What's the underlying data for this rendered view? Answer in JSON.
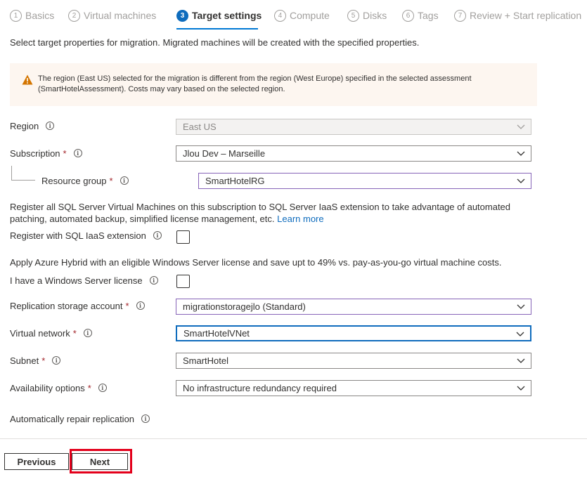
{
  "wizard": {
    "steps": [
      {
        "num": "1",
        "label": "Basics"
      },
      {
        "num": "2",
        "label": "Virtual machines"
      },
      {
        "num": "3",
        "label": "Target settings"
      },
      {
        "num": "4",
        "label": "Compute"
      },
      {
        "num": "5",
        "label": "Disks"
      },
      {
        "num": "6",
        "label": "Tags"
      },
      {
        "num": "7",
        "label": "Review + Start replication"
      }
    ],
    "active_step": "3"
  },
  "intro_text": "Select target properties for migration. Migrated machines will be created with the specified properties.",
  "warning": {
    "icon": "warning-triangle-icon",
    "text": "The region (East US) selected for the migration is different from the region (West Europe) specified in the selected assessment (SmartHotelAssessment). Costs may vary based on the selected region."
  },
  "fields": {
    "region": {
      "label": "Region",
      "value": "East US"
    },
    "subscription": {
      "label": "Subscription",
      "value": "Jlou Dev – Marseille"
    },
    "resource_group": {
      "label": "Resource group",
      "value": "SmartHotelRG"
    },
    "sql_text": "Register all SQL Server Virtual Machines on this subscription to SQL Server IaaS extension to take advantage of automated patching, automated backup, simplified license management, etc.",
    "sql_link": "Learn more",
    "sql_checkbox_label": "Register with SQL IaaS extension",
    "hybrid_text": "Apply Azure Hybrid with an eligible Windows Server license and save upt to 49% vs. pay-as-you-go virtual machine costs.",
    "license_checkbox_label": "I have a Windows Server license",
    "storage": {
      "label": "Replication storage account",
      "value": "migrationstoragejlo (Standard)"
    },
    "vnet": {
      "label": "Virtual network",
      "value": "SmartHotelVNet"
    },
    "subnet": {
      "label": "Subnet",
      "value": "SmartHotel"
    },
    "availability": {
      "label": "Availability options",
      "value": "No infrastructure redundancy required"
    },
    "auto_repair_label": "Automatically repair replication"
  },
  "required_mark": "*",
  "info_glyph": "i",
  "buttons": {
    "previous": "Previous",
    "next": "Next"
  },
  "colors": {
    "accent": "#0f6cbd",
    "warning_bg": "#fdf6f0",
    "warning_icon": "#d47500",
    "required": "#a4262c",
    "highlight": "#e3001b"
  }
}
